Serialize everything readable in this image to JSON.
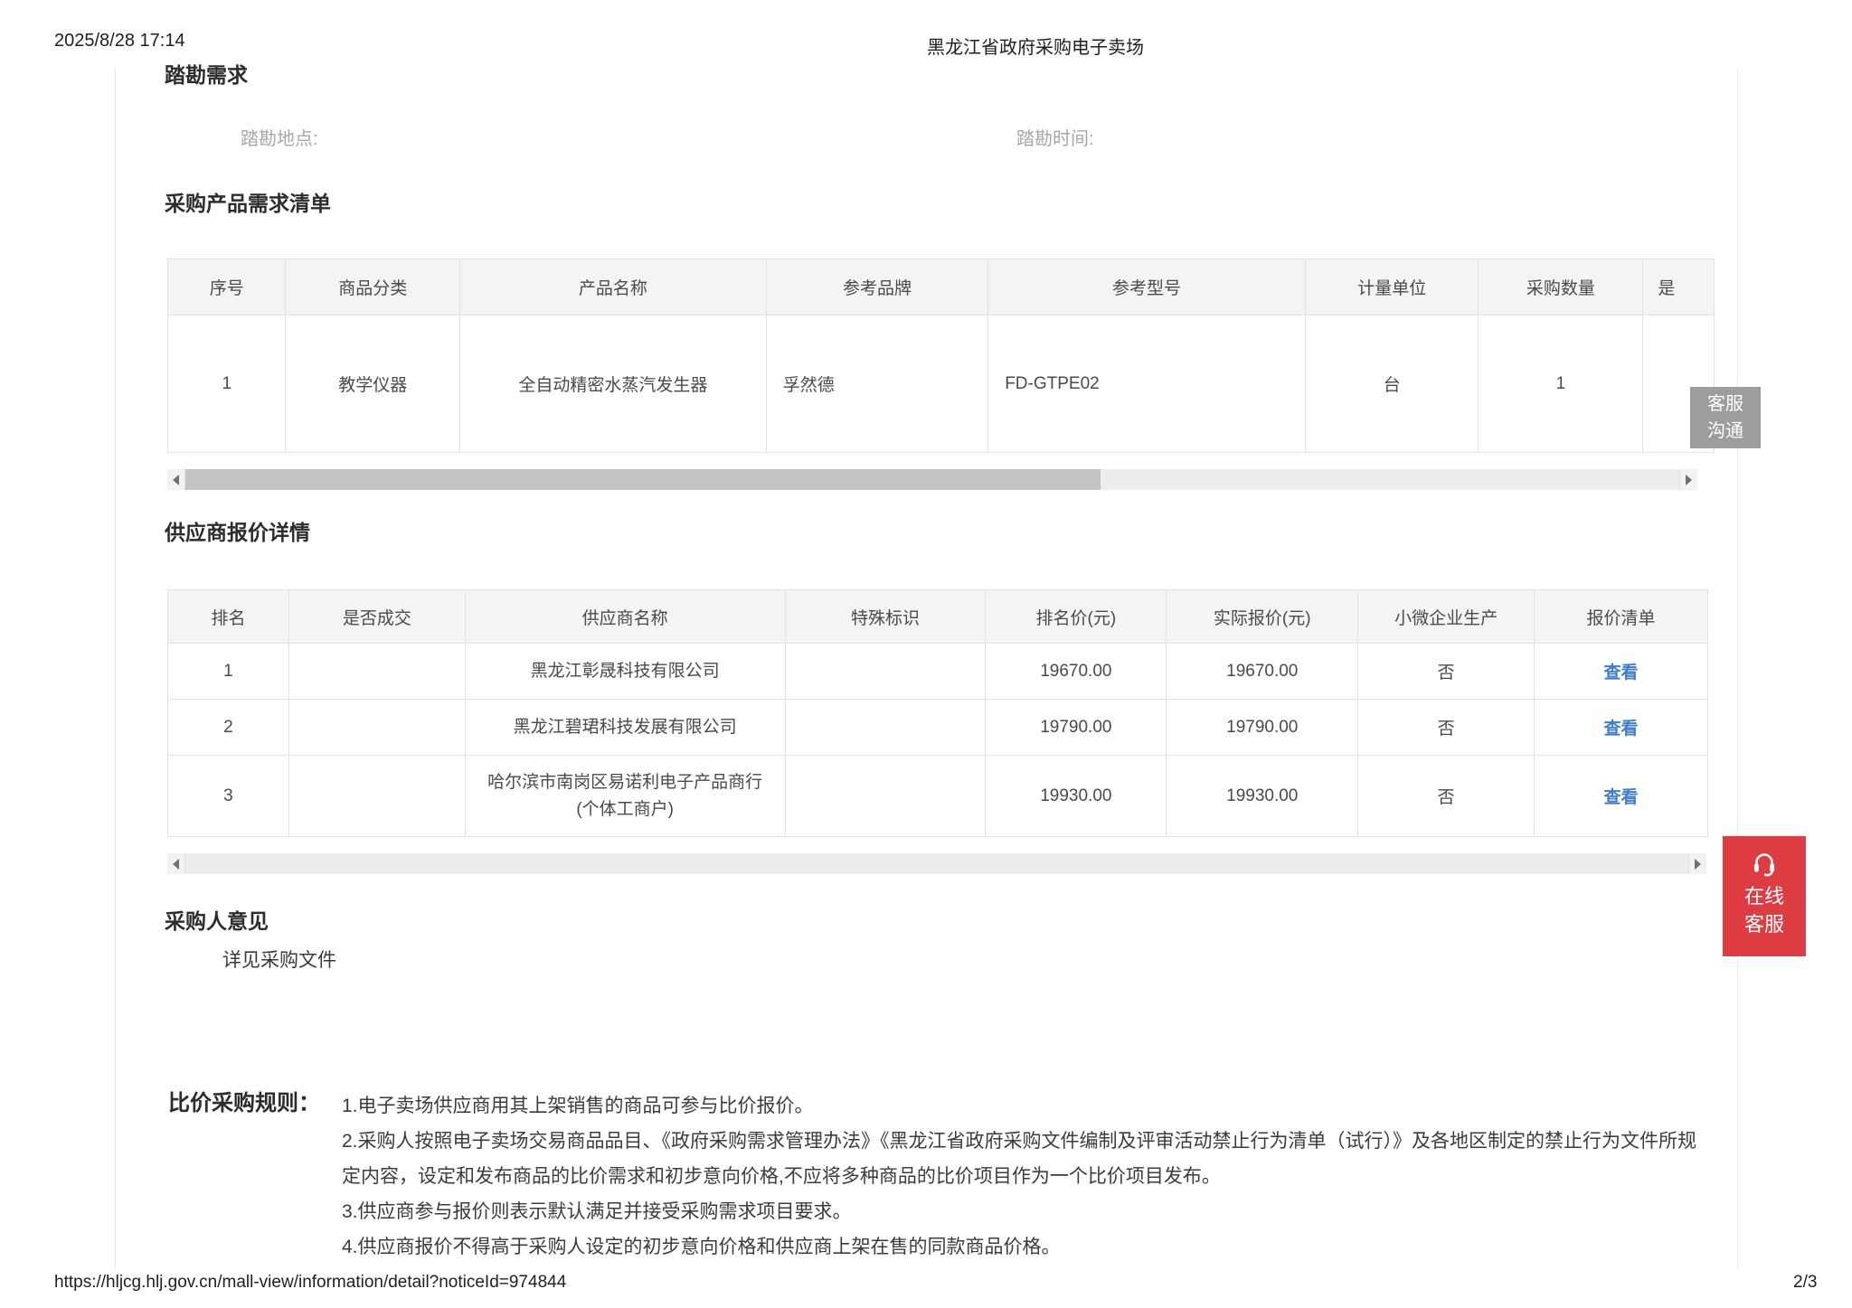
{
  "print_header": {
    "datetime": "2025/8/28 17:14",
    "title": "黑龙江省政府采购电子卖场"
  },
  "survey": {
    "heading": "踏勘需求",
    "location_label": "踏勘地点:",
    "time_label": "踏勘时间:"
  },
  "product_list": {
    "heading": "采购产品需求清单",
    "columns": [
      "序号",
      "商品分类",
      "产品名称",
      "参考品牌",
      "参考型号",
      "计量单位",
      "采购数量",
      "是"
    ],
    "rows": [
      [
        "1",
        "教学仪器",
        "全自动精密水蒸汽发生器",
        "孚然德",
        "FD-GTPE02",
        "台",
        "1",
        ""
      ]
    ]
  },
  "quotes": {
    "heading": "供应商报价详情",
    "columns": [
      "排名",
      "是否成交",
      "供应商名称",
      "特殊标识",
      "排名价(元)",
      "实际报价(元)",
      "小微企业生产",
      "报价清单"
    ],
    "rows": [
      {
        "rank": "1",
        "deal": "",
        "supplier": "黑龙江彰晟科技有限公司",
        "mark": "",
        "rank_price": "19670.00",
        "actual_price": "19670.00",
        "small_micro": "否",
        "link": "查看"
      },
      {
        "rank": "2",
        "deal": "",
        "supplier": "黑龙江碧珺科技发展有限公司",
        "mark": "",
        "rank_price": "19790.00",
        "actual_price": "19790.00",
        "small_micro": "否",
        "link": "查看"
      },
      {
        "rank": "3",
        "deal": "",
        "supplier": "哈尔滨市南岗区易诺利电子产品商行\n(个体工商户)",
        "mark": "",
        "rank_price": "19930.00",
        "actual_price": "19930.00",
        "small_micro": "否",
        "link": "查看"
      }
    ]
  },
  "buyer_opinion": {
    "heading": "采购人意见",
    "text": "详见采购文件"
  },
  "rules": {
    "label": "比价采购规则：",
    "items": [
      "1.电子卖场供应商用其上架销售的商品可参与比价报价。",
      "2.采购人按照电子卖场交易商品品目、《政府采购需求管理办法》《黑龙江省政府采购文件编制及评审活动禁止行为清单（试行）》及各地区制定的禁止行为文件所规定内容，设定和发布商品的比价需求和初步意向价格,不应将多种商品的比价项目作为一个比价项目发布。",
      "3.供应商参与报价则表示默认满足并接受采购需求项目要求。",
      "4.供应商报价不得高于采购人设定的初步意向价格和供应商上架在售的同款商品价格。"
    ]
  },
  "badges": {
    "chat": "客服\n沟通",
    "online": "在线\n客服",
    "headset_icon": "headset-icon"
  },
  "print_footer": {
    "url": "https://hljcg.hlj.gov.cn/mall-view/information/detail?noticeId=974844",
    "page": "2/3"
  },
  "colors": {
    "accent_red": "#dc3c42",
    "badge_gray": "#9d9d9d",
    "link_blue": "#3e7dc8",
    "table_header_bg": "#f4f4f4",
    "table_border": "#e2e2e2",
    "muted_label": "#a7a7a7"
  }
}
